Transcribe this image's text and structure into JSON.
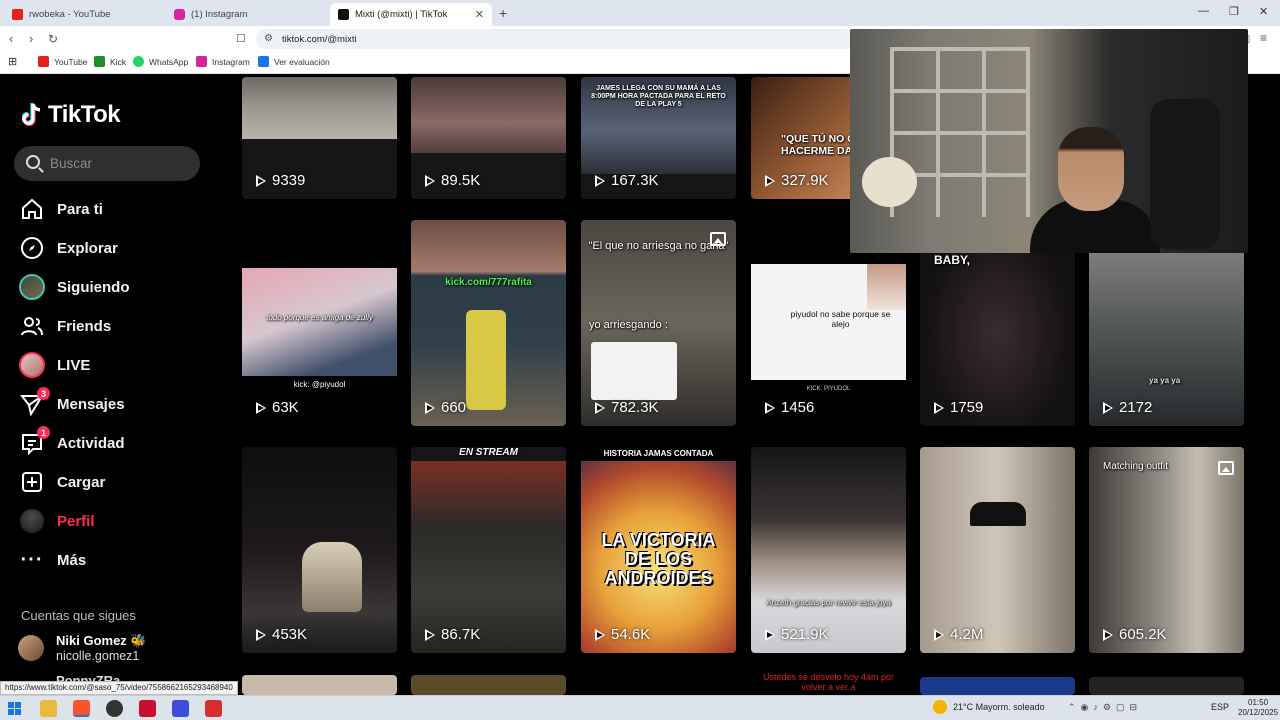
{
  "browser": {
    "tabs": [
      {
        "title": "rwobeka - YouTube",
        "color": "#e62117"
      },
      {
        "title": "(1) Instagram",
        "color": "#d6249f"
      },
      {
        "title": "Mixti (@mixti) | TikTok",
        "color": "#111111"
      }
    ],
    "new_tab": "+",
    "url": "tiktok.com/@mixti",
    "bookmarks": [
      {
        "label": "YouTube",
        "color": "#e62117"
      },
      {
        "label": "Kick",
        "color": "#1f8f2a"
      },
      {
        "label": "WhatsApp",
        "color": "#25d366"
      },
      {
        "label": "Instagram",
        "color": "#d6249f"
      },
      {
        "label": "Ver evaluación",
        "color": "#1a73e8"
      }
    ]
  },
  "sidebar": {
    "logo": "TikTok",
    "search_placeholder": "Buscar",
    "nav": [
      {
        "label": "Para ti",
        "icon": "home-icon"
      },
      {
        "label": "Explorar",
        "icon": "compass-icon"
      },
      {
        "label": "Siguiendo",
        "icon": "following-avatar-icon"
      },
      {
        "label": "Friends",
        "icon": "friends-icon"
      },
      {
        "label": "LIVE",
        "icon": "live-avatar-icon"
      },
      {
        "label": "Mensajes",
        "icon": "messages-icon",
        "badge": "3"
      },
      {
        "label": "Actividad",
        "icon": "activity-icon",
        "badge": "1"
      },
      {
        "label": "Cargar",
        "icon": "upload-icon"
      },
      {
        "label": "Perfil",
        "icon": "profile-avatar-icon",
        "active": true
      },
      {
        "label": "Más",
        "icon": "more-icon"
      }
    ],
    "following_heading": "Cuentas que sigues",
    "following": [
      {
        "name": "Niki Gomez 🐝",
        "handle": "nicolle.gomez1"
      },
      {
        "name": "PonnyZRa"
      }
    ]
  },
  "grid": {
    "row1": [
      {
        "views": "9339",
        "caption": ""
      },
      {
        "views": "89.5K",
        "caption": ""
      },
      {
        "views": "167.3K",
        "caption": "JAMES LLEGA CON SU MAMÁ A LAS 8:00PM HORA PACTADA PARA EL RETO DE LA PLAY 5"
      },
      {
        "views": "327.9K",
        "caption": "\"QUE TÚ NO QU... HACERME DAÑ..."
      }
    ],
    "row2": [
      {
        "views": "63K",
        "caption": "todo porque es amiga de zully",
        "credit": "kick: @piyudol"
      },
      {
        "views": "660",
        "caption": "kick.com/777rafita"
      },
      {
        "views": "782.3K",
        "caption": "\"El que no arriesga no gana\"",
        "caption2": "yo arriesgando :"
      },
      {
        "views": "1456",
        "caption": "piyudol no sabe porque se alejo",
        "credit": "KICK: PIYUDOL"
      },
      {
        "views": "1759",
        "caption": "BABY,"
      },
      {
        "views": "2172",
        "caption": "ya ya ya"
      }
    ],
    "row3": [
      {
        "views": "453K",
        "caption": ""
      },
      {
        "views": "86.7K",
        "caption": "EN STREAM"
      },
      {
        "views": "54.6K",
        "caption": "HISTORIA JAMAS CONTADA",
        "title": "LA VICTORIA DE LOS ANDROIDES"
      },
      {
        "views": "521.9K",
        "caption": "Anzeth gracias por revivir esta joya"
      },
      {
        "views": "4.2M",
        "caption": ""
      },
      {
        "views": "605.2K",
        "caption": "Matching outfit"
      }
    ],
    "row4_caption": "Ustedes se desvelo hoy 4am por volver a ver a"
  },
  "status_url": "https://www.tiktok.com/@saso_75/video/7558662165293468940",
  "taskbar": {
    "weather": "21°C  Mayorm. soleado",
    "lang": "ESP",
    "time": "01:50",
    "date": "20/12/2025"
  }
}
